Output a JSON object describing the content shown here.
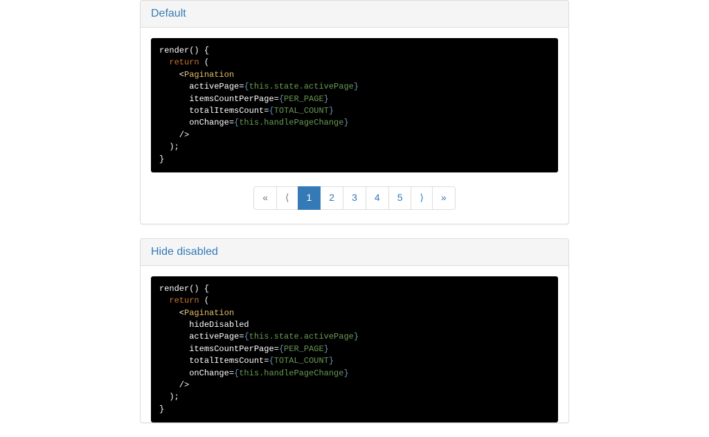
{
  "sections": [
    {
      "title": "Default",
      "code_tokens": [
        {
          "t": "plain",
          "v": "render() {\n  "
        },
        {
          "t": "kw",
          "v": "return"
        },
        {
          "t": "plain",
          "v": " (\n    <"
        },
        {
          "t": "tag",
          "v": "Pagination"
        },
        {
          "t": "plain",
          "v": "\n      "
        },
        {
          "t": "attrname",
          "v": "activePage"
        },
        {
          "t": "plain",
          "v": "="
        },
        {
          "t": "brace",
          "v": "{"
        },
        {
          "t": "expr",
          "v": "this.state.activePage"
        },
        {
          "t": "brace",
          "v": "}"
        },
        {
          "t": "plain",
          "v": "\n      "
        },
        {
          "t": "attrname",
          "v": "itemsCountPerPage"
        },
        {
          "t": "plain",
          "v": "="
        },
        {
          "t": "brace",
          "v": "{"
        },
        {
          "t": "expr",
          "v": "PER_PAGE"
        },
        {
          "t": "brace",
          "v": "}"
        },
        {
          "t": "plain",
          "v": "\n      "
        },
        {
          "t": "attrname",
          "v": "totalItemsCount"
        },
        {
          "t": "plain",
          "v": "="
        },
        {
          "t": "brace",
          "v": "{"
        },
        {
          "t": "expr",
          "v": "TOTAL_COUNT"
        },
        {
          "t": "brace",
          "v": "}"
        },
        {
          "t": "plain",
          "v": "\n      "
        },
        {
          "t": "attrname",
          "v": "onChange"
        },
        {
          "t": "plain",
          "v": "="
        },
        {
          "t": "brace",
          "v": "{"
        },
        {
          "t": "expr",
          "v": "this.handlePageChange"
        },
        {
          "t": "brace",
          "v": "}"
        },
        {
          "t": "plain",
          "v": "\n    />\n  );\n}"
        }
      ],
      "pagination": {
        "first": "«",
        "prev": "⟨",
        "pages": [
          "1",
          "2",
          "3",
          "4",
          "5"
        ],
        "active": "1",
        "next": "⟩",
        "last": "»"
      }
    },
    {
      "title": "Hide disabled",
      "code_tokens": [
        {
          "t": "plain",
          "v": "render() {\n  "
        },
        {
          "t": "kw",
          "v": "return"
        },
        {
          "t": "plain",
          "v": " (\n    <"
        },
        {
          "t": "tag",
          "v": "Pagination"
        },
        {
          "t": "plain",
          "v": "\n      "
        },
        {
          "t": "attrname",
          "v": "hideDisabled"
        },
        {
          "t": "plain",
          "v": "\n      "
        },
        {
          "t": "attrname",
          "v": "activePage"
        },
        {
          "t": "plain",
          "v": "="
        },
        {
          "t": "brace",
          "v": "{"
        },
        {
          "t": "expr",
          "v": "this.state.activePage"
        },
        {
          "t": "brace",
          "v": "}"
        },
        {
          "t": "plain",
          "v": "\n      "
        },
        {
          "t": "attrname",
          "v": "itemsCountPerPage"
        },
        {
          "t": "plain",
          "v": "="
        },
        {
          "t": "brace",
          "v": "{"
        },
        {
          "t": "expr",
          "v": "PER_PAGE"
        },
        {
          "t": "brace",
          "v": "}"
        },
        {
          "t": "plain",
          "v": "\n      "
        },
        {
          "t": "attrname",
          "v": "totalItemsCount"
        },
        {
          "t": "plain",
          "v": "="
        },
        {
          "t": "brace",
          "v": "{"
        },
        {
          "t": "expr",
          "v": "TOTAL_COUNT"
        },
        {
          "t": "brace",
          "v": "}"
        },
        {
          "t": "plain",
          "v": "\n      "
        },
        {
          "t": "attrname",
          "v": "onChange"
        },
        {
          "t": "plain",
          "v": "="
        },
        {
          "t": "brace",
          "v": "{"
        },
        {
          "t": "expr",
          "v": "this.handlePageChange"
        },
        {
          "t": "brace",
          "v": "}"
        },
        {
          "t": "plain",
          "v": "\n    />\n  );\n}"
        }
      ]
    }
  ]
}
